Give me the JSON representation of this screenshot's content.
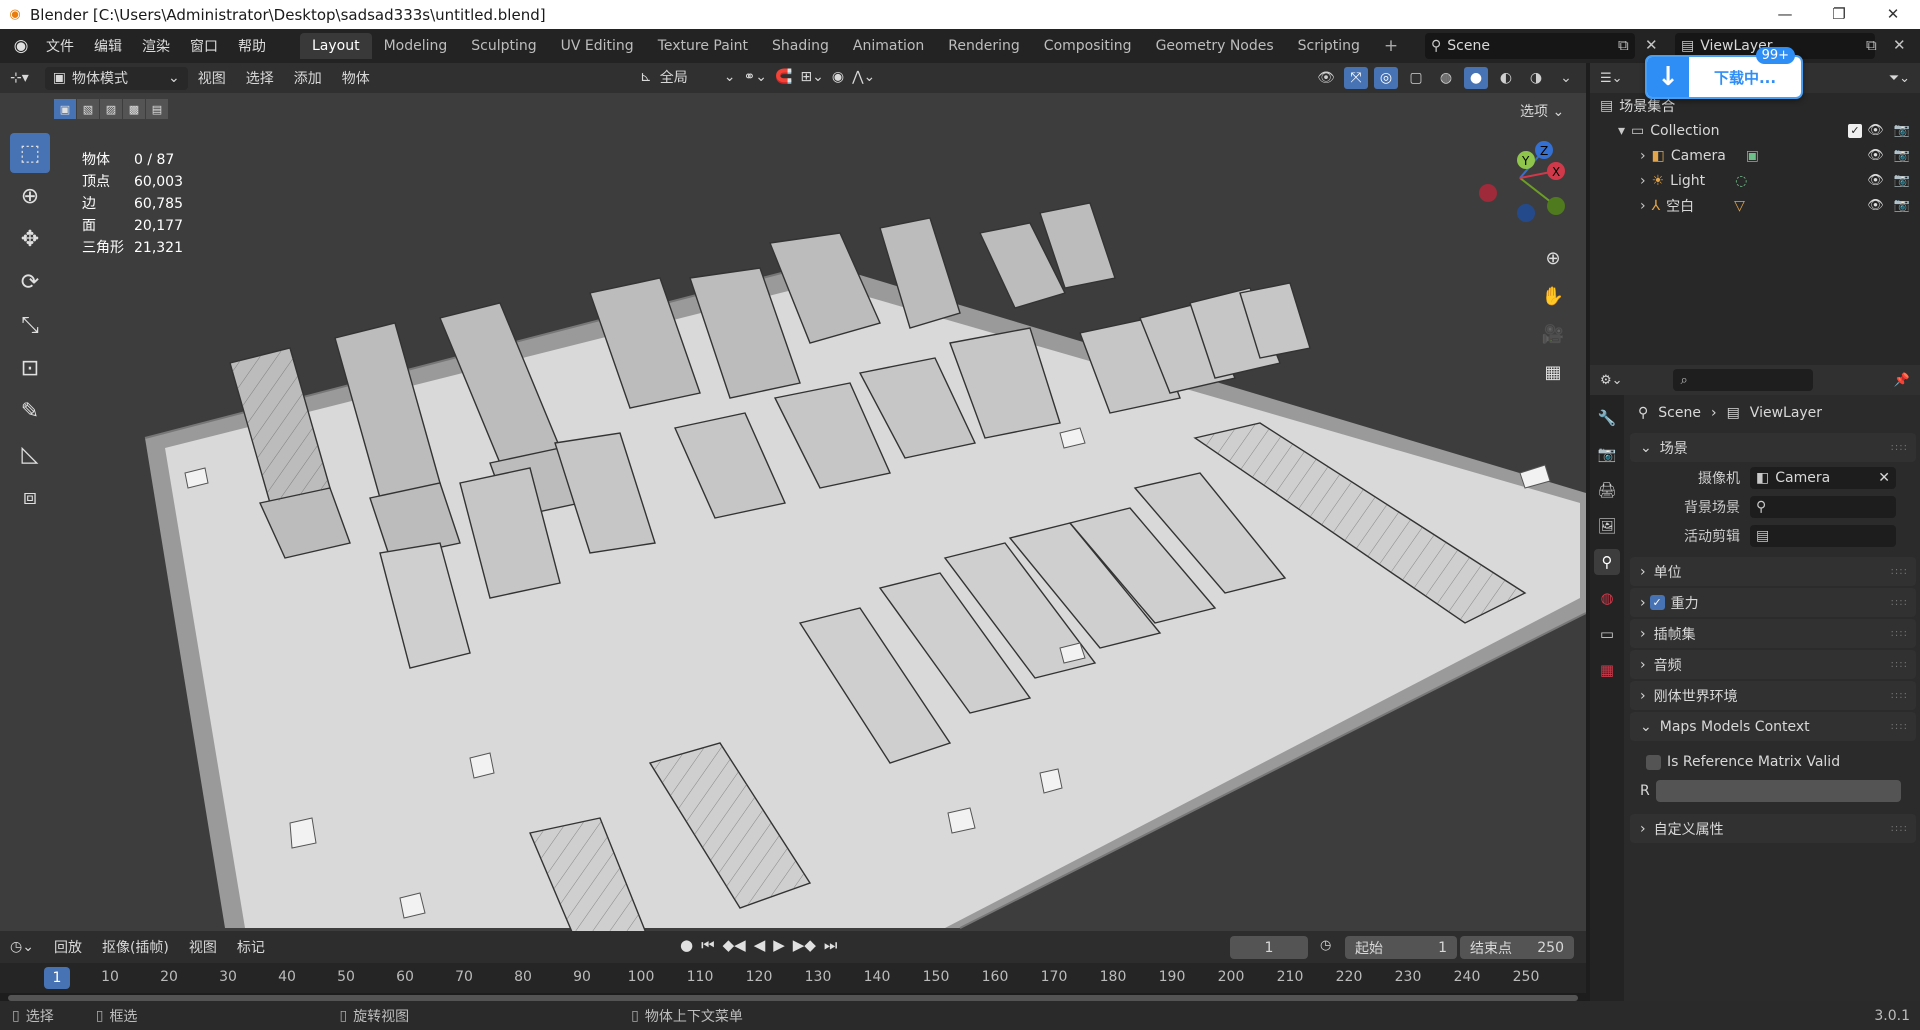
{
  "window": {
    "title": "Blender [C:\\Users\\Administrator\\Desktop\\sadsad333s\\untitled.blend]",
    "buttons": [
      "—",
      "❐",
      "✕"
    ]
  },
  "menubar": {
    "items": [
      "文件",
      "编辑",
      "渲染",
      "窗口",
      "帮助"
    ],
    "tabs": [
      "Layout",
      "Modeling",
      "Sculpting",
      "UV Editing",
      "Texture Paint",
      "Shading",
      "Animation",
      "Rendering",
      "Compositing",
      "Geometry Nodes",
      "Scripting"
    ],
    "active_tab": "Layout",
    "scene": "Scene",
    "view_layer": "ViewLayer"
  },
  "download_badge": {
    "text": "下载中...",
    "count": "99+"
  },
  "viewport_header": {
    "mode": "物体模式",
    "menus": [
      "视图",
      "选择",
      "添加",
      "物体"
    ],
    "orientation": "全局",
    "options": "选项"
  },
  "stats": [
    {
      "label": "物体",
      "value": "0 / 87"
    },
    {
      "label": "顶点",
      "value": "60,003"
    },
    {
      "label": "边",
      "value": "60,785"
    },
    {
      "label": "面",
      "value": "20,177"
    },
    {
      "label": "三角形",
      "value": "21,321"
    }
  ],
  "gizmo": {
    "x": "X",
    "y": "Y",
    "z": "Z"
  },
  "timeline": {
    "menus": [
      "回放",
      "抠像(插帧)",
      "视图",
      "标记"
    ],
    "current_frame": "1",
    "start_label": "起始",
    "start": "1",
    "end_label": "结束点",
    "end": "250",
    "ruler": [
      "1",
      "10",
      "20",
      "30",
      "40",
      "50",
      "60",
      "70",
      "80",
      "90",
      "100",
      "110",
      "120",
      "130",
      "140",
      "150",
      "160",
      "170",
      "180",
      "190",
      "200",
      "210",
      "220",
      "230",
      "240",
      "250"
    ]
  },
  "statusbar": {
    "select": "选择",
    "box_select": "框选",
    "rotate": "旋转视图",
    "context_menu": "物体上下文菜单",
    "version": "3.0.1"
  },
  "outliner": {
    "root": "场景集合",
    "collection": "Collection",
    "items": [
      {
        "name": "Camera",
        "icon": "camera-icon"
      },
      {
        "name": "Light",
        "icon": "light-icon"
      },
      {
        "name": "空白",
        "icon": "empty-icon"
      }
    ]
  },
  "properties": {
    "breadcrumb": [
      "Scene",
      "ViewLayer"
    ],
    "scene_panel": "场景",
    "camera_label": "摄像机",
    "camera_value": "Camera",
    "bg_scene_label": "背景场景",
    "active_clip_label": "活动剪辑",
    "panels": [
      "单位",
      "重力",
      "插帧集",
      "音频",
      "刚体世界环境",
      "Maps Models Context"
    ],
    "ref_matrix": "Is Reference Matrix Valid",
    "r_label": "R",
    "custom_props": "自定义属性"
  },
  "colors": {
    "accent": "#4772b3",
    "viewport_bg": "#3d3d3d",
    "ground": "#d6d6d6"
  }
}
